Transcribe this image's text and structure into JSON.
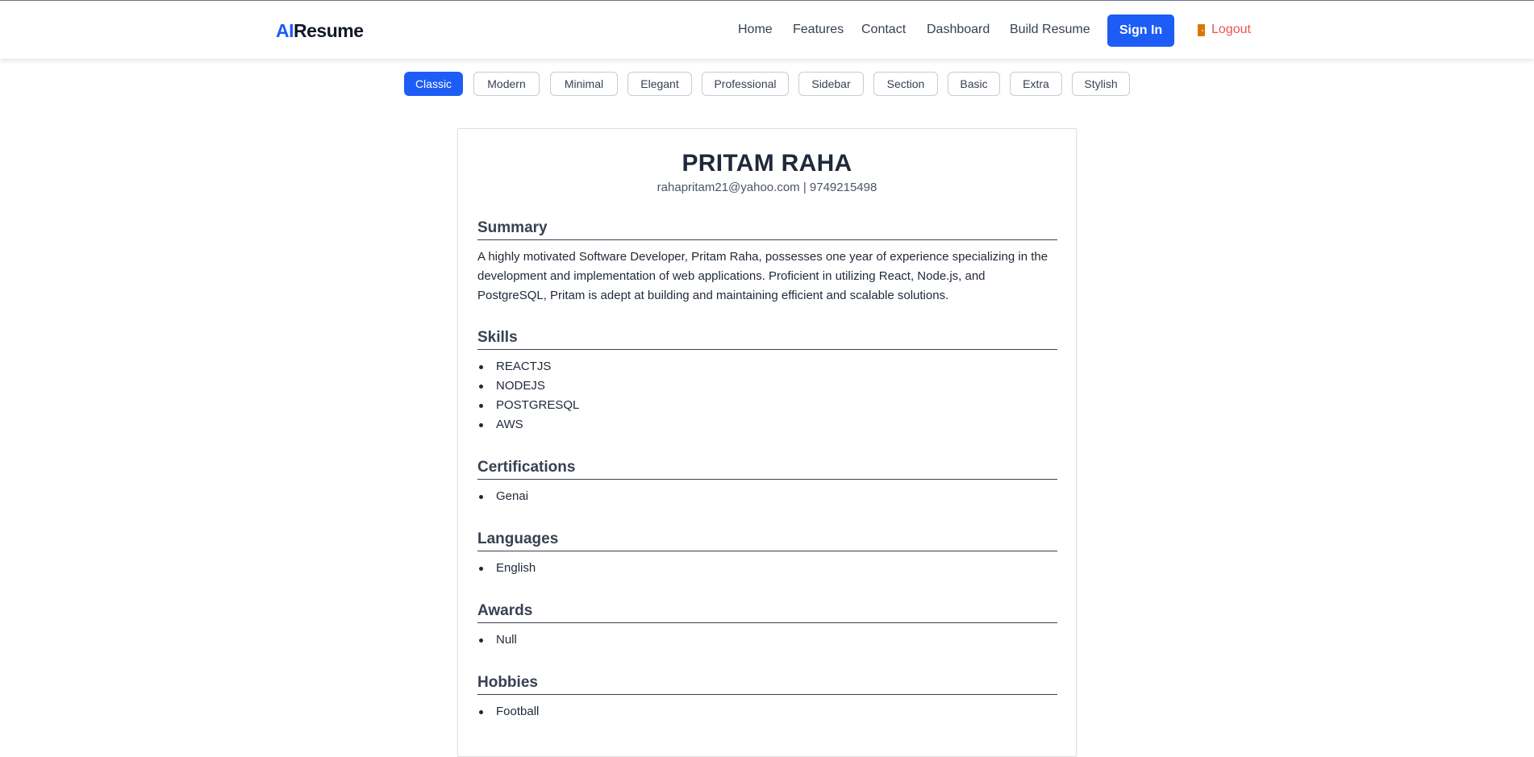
{
  "navbar": {
    "logo_ai": "AI",
    "logo_rest": "Resume",
    "links": [
      "Home",
      "Features",
      "Contact",
      "Dashboard",
      "Build Resume"
    ],
    "signin_label": "Sign In",
    "logout_label": "Logout",
    "logout_icon": "door-icon"
  },
  "templates": {
    "items": [
      "Classic",
      "Modern",
      "Minimal",
      "Elegant",
      "Professional",
      "Sidebar",
      "Section",
      "Basic",
      "Extra",
      "Stylish"
    ],
    "selected": "Classic"
  },
  "resume": {
    "name": "PRITAM RAHA",
    "contact": "rahapritam21@yahoo.com | 9749215498",
    "summary_title": "Summary",
    "summary_text": "A highly motivated Software Developer, Pritam Raha, possesses one year of experience specializing in the development and implementation of web applications. Proficient in utilizing React, Node.js, and PostgreSQL, Pritam is adept at building and maintaining efficient and scalable solutions.",
    "skills_title": "Skills",
    "skills": [
      "REACTJS",
      "NODEJS",
      "POSTGRESQL",
      "AWS"
    ],
    "certifications_title": "Certifications",
    "certifications": [
      "Genai"
    ],
    "languages_title": "Languages",
    "languages": [
      "English"
    ],
    "awards_title": "Awards",
    "awards": [
      "Null"
    ],
    "hobbies_title": "Hobbies",
    "hobbies": [
      "Football"
    ]
  },
  "colors": {
    "accent": "#1d5cf5",
    "logout": "#ef5350",
    "heading": "#1e293b"
  }
}
